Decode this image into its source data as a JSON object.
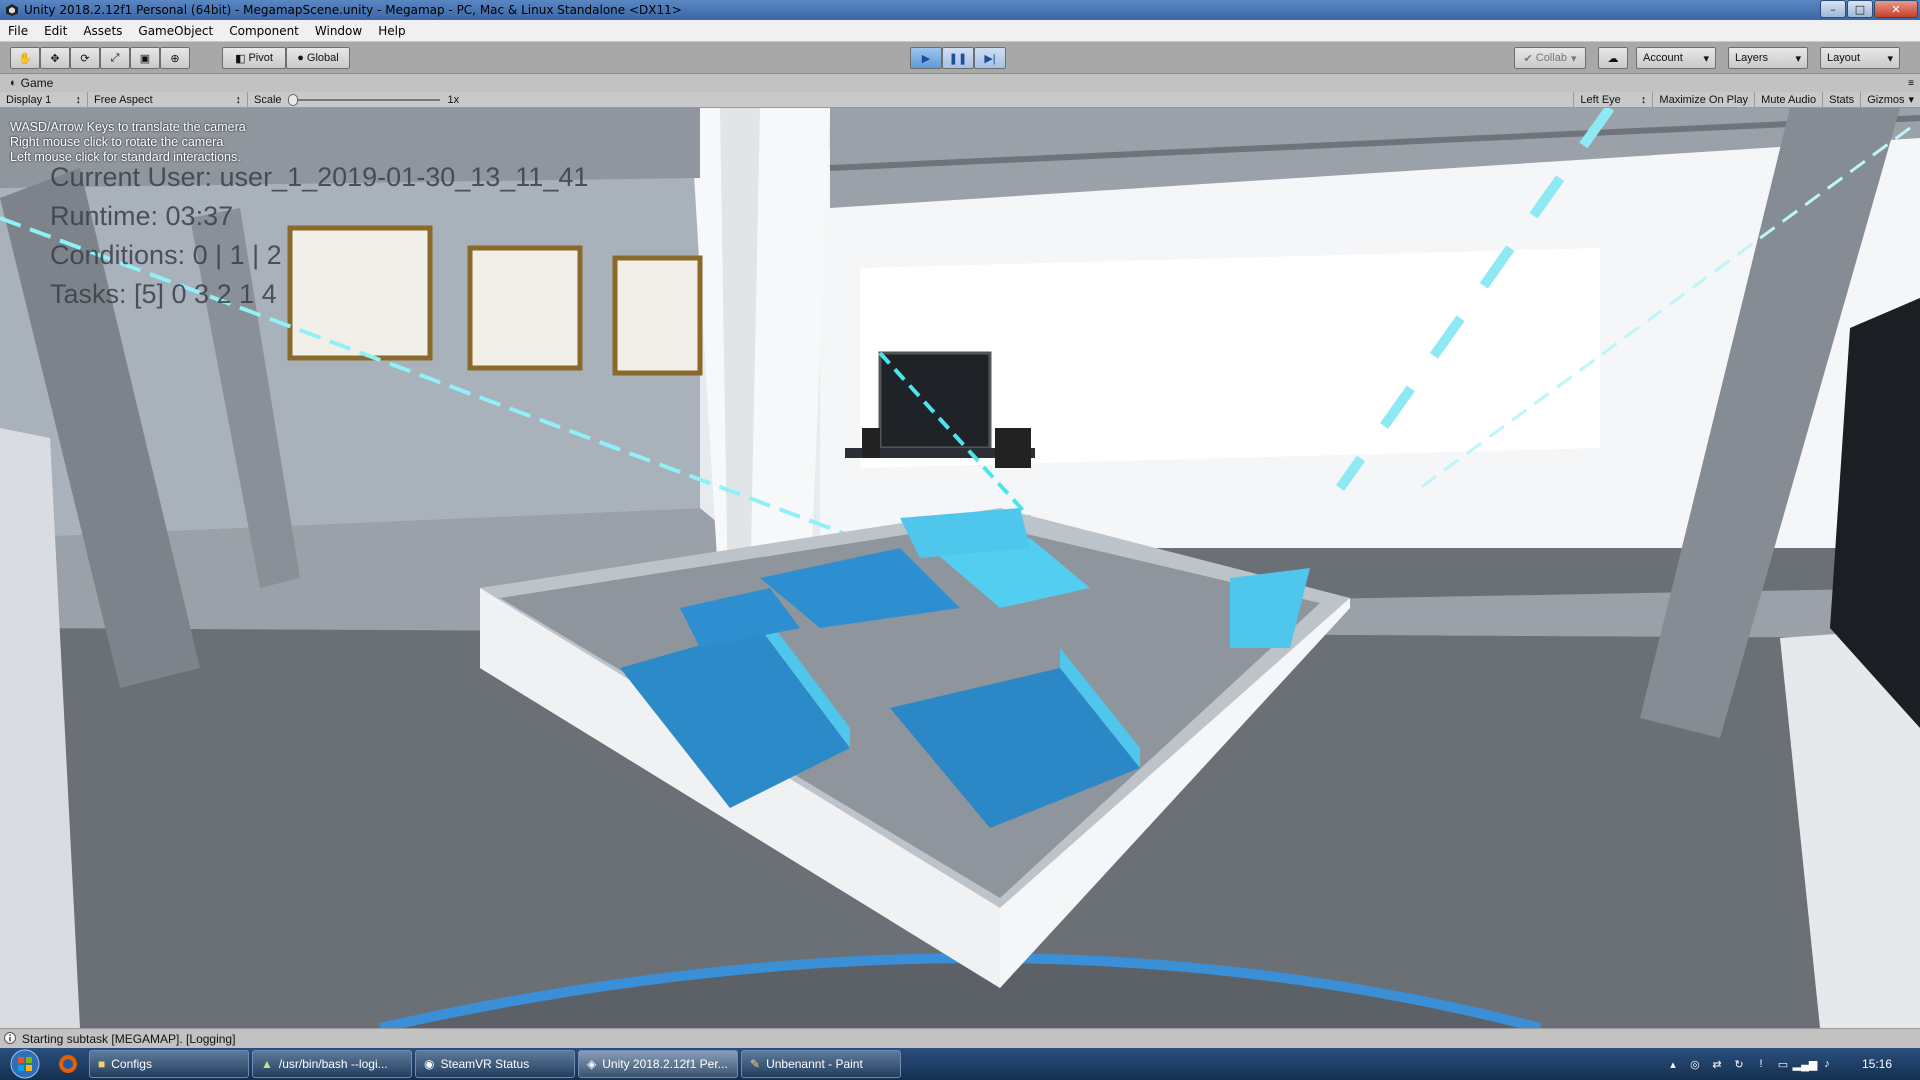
{
  "window": {
    "title": "Unity 2018.2.12f1 Personal (64bit) - MegamapScene.unity - Megamap - PC, Mac & Linux Standalone <DX11>",
    "minimize": "–",
    "maximize": "□",
    "close": "✕"
  },
  "menu": [
    "File",
    "Edit",
    "Assets",
    "GameObject",
    "Component",
    "Window",
    "Help"
  ],
  "toolbar": {
    "pivot": "Pivot",
    "global": "Global",
    "collab": "Collab",
    "account": "Account",
    "layers": "Layers",
    "layout": "Layout"
  },
  "game_tab": {
    "label": "Game",
    "display": "Display 1",
    "aspect": "Free Aspect",
    "scale_label": "Scale",
    "scale_value": "1x",
    "eye": "Left Eye",
    "maximize_on_play": "Maximize On Play",
    "mute_audio": "Mute Audio",
    "stats": "Stats",
    "gizmos": "Gizmos"
  },
  "overlay": {
    "help": [
      "WASD/Arrow Keys to translate the camera",
      "Right mouse click to rotate the camera",
      "Left mouse click for standard interactions."
    ],
    "current_user": "Current User: user_1_2019-01-30_13_11_41",
    "runtime": "Runtime: 03:37",
    "conditions": "Conditions: 0 | 1 | 2",
    "tasks": "Tasks: [5] 0 3 2 1 4"
  },
  "status": {
    "message": "Starting subtask [MEGAMAP]. [Logging]"
  },
  "taskbar": {
    "items": [
      {
        "label": "Configs"
      },
      {
        "label": "/usr/bin/bash --logi..."
      },
      {
        "label": "SteamVR Status"
      },
      {
        "label": "Unity 2018.2.12f1 Per..."
      },
      {
        "label": "Unbenannt - Paint"
      }
    ],
    "clock": "15:16"
  }
}
